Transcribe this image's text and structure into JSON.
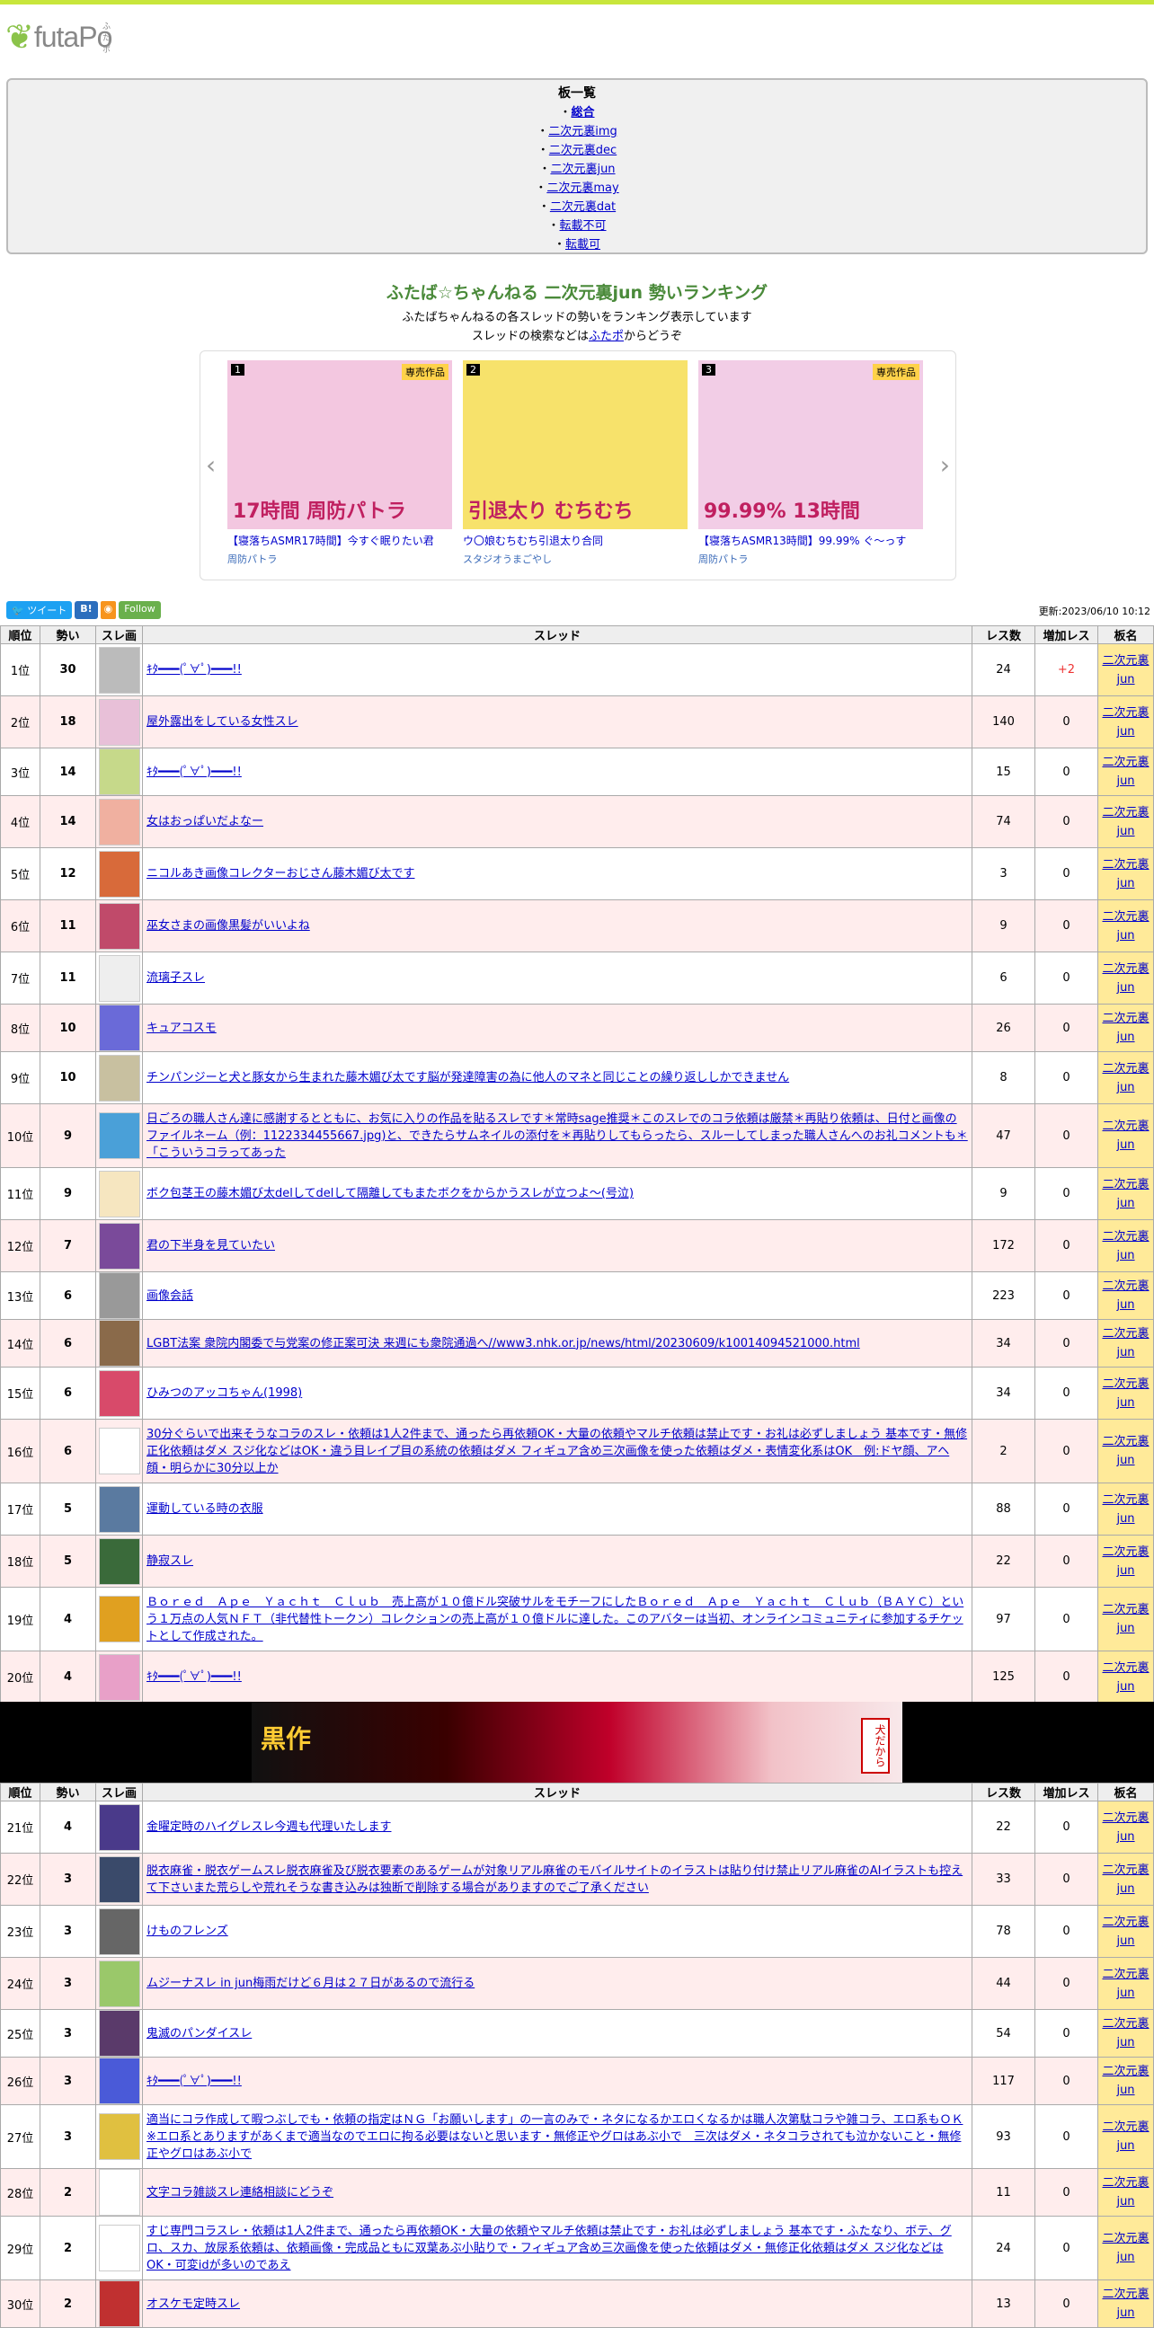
{
  "site": {
    "logo_mark": "❦",
    "logo_text": "futaPo",
    "logo_sub": "ふたポ"
  },
  "boards": {
    "heading": "板一覧",
    "items": [
      {
        "prefix": "・",
        "label": "総合"
      },
      {
        "prefix": "・",
        "label": "二次元裏img"
      },
      {
        "prefix": "・",
        "label": "二次元裏dec"
      },
      {
        "prefix": "・",
        "label": "二次元裏jun"
      },
      {
        "prefix": "・",
        "label": "二次元裏may"
      },
      {
        "prefix": "・",
        "label": "二次元裏dat"
      },
      {
        "prefix": "・",
        "label": "転載不可"
      },
      {
        "prefix": "・",
        "label": "転載可"
      }
    ]
  },
  "ranking": {
    "title": "ふたば☆ちゃんねる 二次元裏jun 勢いランキング",
    "desc1": "ふたばちゃんねるの各スレッドの勢いをランキング表示しています",
    "desc2_pre": "スレッドの検索などは",
    "desc2_link": "ふたポ",
    "desc2_post": "からどうぞ"
  },
  "carousel": {
    "prev": "‹",
    "next": "›",
    "items": [
      {
        "num": "1",
        "badge": "専売作品",
        "title": "【寝落ちASMR17時間】今すぐ眠りたい君",
        "circle": "周防パトラ",
        "bg": "#f3c7e0",
        "img_text": "17時間 周防パトラ"
      },
      {
        "num": "2",
        "badge": "",
        "title": "ウ〇娘むちむち引退太り合同",
        "circle": "スタジオうまごやし",
        "bg": "#f7e26b",
        "img_text": "引退太り むちむち"
      },
      {
        "num": "3",
        "badge": "専売作品",
        "title": "【寝落ちASMR13時間】99.99% ぐ～っす",
        "circle": "周防パトラ",
        "bg": "#f2cde6",
        "img_text": "99.99% 13時間"
      }
    ]
  },
  "share": {
    "tweet": "ツイート",
    "hatena": "B!",
    "rss": "RSS",
    "follow": "Follow"
  },
  "updated": "更新:2023/06/10 10:12",
  "table": {
    "headers": [
      "順位",
      "勢い",
      "スレ画",
      "スレッド",
      "レス数",
      "増加レス",
      "板名"
    ],
    "board_line1": "二次元裏",
    "board_line2": "jun",
    "rows": [
      {
        "rank": "1位",
        "ikioi": "30",
        "title": "ｷﾀ━━━(ﾟ∀ﾟ)━━━!!",
        "res": "24",
        "inc": "+2",
        "h": 58,
        "img": "#bbb"
      },
      {
        "rank": "2位",
        "ikioi": "18",
        "title": "屋外露出をしている女性スレ",
        "res": "140",
        "inc": "0",
        "h": 58,
        "img": "#e8c0d8"
      },
      {
        "rank": "3位",
        "ikioi": "14",
        "title": "ｷﾀ━━━(ﾟ∀ﾟ)━━━!!",
        "res": "15",
        "inc": "0",
        "h": 46,
        "img": "#c6d98a"
      },
      {
        "rank": "4位",
        "ikioi": "14",
        "title": "女はおっぱいだよなー",
        "res": "74",
        "inc": "0",
        "h": 58,
        "img": "#f0b0a0"
      },
      {
        "rank": "5位",
        "ikioi": "12",
        "title": "ニコルあき画像コレクターおじさん藤木媚び太です",
        "res": "3",
        "inc": "0",
        "h": 58,
        "img": "#d86a3a"
      },
      {
        "rank": "6位",
        "ikioi": "11",
        "title": "巫女さまの画像黒髪がいいよね",
        "res": "9",
        "inc": "0",
        "h": 58,
        "img": "#c04a6a"
      },
      {
        "rank": "7位",
        "ikioi": "11",
        "title": "流璃子スレ",
        "res": "6",
        "inc": "0",
        "h": 58,
        "img": "#eee"
      },
      {
        "rank": "8位",
        "ikioi": "10",
        "title": "キュアコスモ",
        "res": "26",
        "inc": "0",
        "h": 44,
        "img": "#6a6ad8"
      },
      {
        "rank": "9位",
        "ikioi": "10",
        "title": "チンパンジーと犬と豚女から生まれた藤木媚び太です脳が発達障害の為に他人のマネと同じことの繰り返ししかできません",
        "res": "8",
        "inc": "0",
        "h": 58,
        "img": "#c8c0a0"
      },
      {
        "rank": "10位",
        "ikioi": "9",
        "title": "日ごろの職人さん達に感謝するとともに、お気に入りの作品を貼るスレです＊常時sage推奨＊このスレでのコラ依頼は厳禁＊再貼り依頼は、日付と画像のファイルネーム（例：1122334455667.jpg)と、できたらサムネイルの添付を＊再貼りしてもらったら、スルーしてしまった職人さんへのお礼コメントも＊「こういうコラってあった",
        "res": "47",
        "inc": "0",
        "h": 71,
        "img": "#4aa0d8"
      },
      {
        "rank": "11位",
        "ikioi": "9",
        "title": "ボク包茎王の藤木媚び太delしてdelして隔離してもまたボクをからかうスレが立つよ～(号泣)",
        "res": "9",
        "inc": "0",
        "h": 58,
        "img": "#f6e6c0"
      },
      {
        "rank": "12位",
        "ikioi": "7",
        "title": "君の下半身を見ていたい",
        "res": "172",
        "inc": "0",
        "h": 58,
        "img": "#7a4a9a"
      },
      {
        "rank": "13位",
        "ikioi": "6",
        "title": "画像会話",
        "res": "223",
        "inc": "0",
        "h": 44,
        "img": "#999"
      },
      {
        "rank": "14位",
        "ikioi": "6",
        "title": "LGBT法案 衆院内閣委で与党案の修正案可決 来週にも衆院通過へ//www3.nhk.or.jp/news/html/20230609/k10014094521000.html",
        "res": "34",
        "inc": "0",
        "h": 44,
        "img": "#8a6a4a"
      },
      {
        "rank": "15位",
        "ikioi": "6",
        "title": "ひみつのアッコちゃん(1998)",
        "res": "34",
        "inc": "0",
        "h": 58,
        "img": "#d84a6a"
      },
      {
        "rank": "16位",
        "ikioi": "6",
        "title": "30分ぐらいで出来そうなコラのスレ・依頼は1人2件まで、通ったら再依頼OK・大量の依頼やマルチ依頼は禁止です・お礼は必ずしましょう 基本です・無修正化依頼はダメ スジ化などはOK・違う目レイプ目の系統の依頼はダメ フィギュア含め三次画像を使った依頼はダメ・表情変化系はOK　例:ドヤ顔、アヘ顔・明らかに30分以上か",
        "res": "2",
        "inc": "0",
        "h": 71,
        "img": "#fff"
      },
      {
        "rank": "17位",
        "ikioi": "5",
        "title": "運動している時の衣服",
        "res": "88",
        "inc": "0",
        "h": 58,
        "img": "#5a7aa0"
      },
      {
        "rank": "18位",
        "ikioi": "5",
        "title": "静寂スレ",
        "res": "22",
        "inc": "0",
        "h": 58,
        "img": "#3a6a3a"
      },
      {
        "rank": "19位",
        "ikioi": "4",
        "title": "Ｂｏｒｅｄ　Ａｐｅ　Ｙａｃｈｔ　Ｃｌｕｂ　売上高が１０億ドル突破サルをモチーフにしたＢｏｒｅｄ　Ａｐｅ　Ｙａｃｈｔ　Ｃｌｕｂ（ＢＡＹＣ）という１万点の人気ＮＦＴ（非代替性トークン）コレクションの売上高が１０億ドルに達した。このアバターは当初、オンラインコミュニティに参加するチケットとして作成された。",
        "res": "97",
        "inc": "0",
        "h": 71,
        "img": "#e0a020"
      },
      {
        "rank": "20位",
        "ikioi": "4",
        "title": "ｷﾀ━━━(ﾟ∀ﾟ)━━━!!",
        "res": "125",
        "inc": "0",
        "h": 58,
        "img": "#e8a0c8"
      }
    ],
    "rows2": [
      {
        "rank": "21位",
        "ikioi": "4",
        "title": "金曜定時のハイグレスレ今週も代理いたします",
        "res": "22",
        "inc": "0",
        "h": 58,
        "img": "#4a3a8a"
      },
      {
        "rank": "22位",
        "ikioi": "3",
        "title": "脱衣麻雀・脱衣ゲームスレ脱衣麻雀及び脱衣要素のあるゲームが対象リアル麻雀のモバイルサイトのイラストは貼り付け禁止リアル麻雀のAIイラストも控えて下さいまた荒らしや荒れそうな書き込みは独断で削除する場合がありますのでご了承ください",
        "res": "33",
        "inc": "0",
        "h": 58,
        "img": "#3a4a6a"
      },
      {
        "rank": "23位",
        "ikioi": "3",
        "title": "けものフレンズ",
        "res": "78",
        "inc": "0",
        "h": 58,
        "img": "#666"
      },
      {
        "rank": "24位",
        "ikioi": "3",
        "title": "ムジーナスレ in jun梅雨だけど６月は２７日があるので流行る",
        "res": "44",
        "inc": "0",
        "h": 58,
        "img": "#9ac86a"
      },
      {
        "rank": "25位",
        "ikioi": "3",
        "title": "鬼滅のパンダイスレ",
        "res": "54",
        "inc": "0",
        "h": 44,
        "img": "#5a3a6a"
      },
      {
        "rank": "26位",
        "ikioi": "3",
        "title": "ｷﾀ━━━(ﾟ∀ﾟ)━━━!!",
        "res": "117",
        "inc": "0",
        "h": 44,
        "img": "#4a5ad8"
      },
      {
        "rank": "27位",
        "ikioi": "3",
        "title": "適当にコラ作成して暇つぶしでも・依頼の指定はＮＧ「お願いします」の一言のみで・ネタになるかエロくなるかは職人次第駄コラや雑コラ、エロ系もＯＫ※エロ系とありますがあくまで適当なのでエロに拘る必要はないと思います・無修正やグロはあぶ小で　三次はダメ・ネタコラされても泣かないこと・無修正やグロはあぶ小で",
        "res": "93",
        "inc": "0",
        "h": 71,
        "img": "#e0c040"
      },
      {
        "rank": "28位",
        "ikioi": "2",
        "title": "文字コラ雑談スレ連絡相談にどうぞ",
        "res": "11",
        "inc": "0",
        "h": 44,
        "img": "#fff"
      },
      {
        "rank": "29位",
        "ikioi": "2",
        "title": "すじ専門コラスレ・依頼は1人2件まで、通ったら再依頼OK・大量の依頼やマルチ依頼は禁止です・お礼は必ずしましょう 基本です・ふたなり、ボテ、グロ、スカ、放尿系依頼は、依頼画像・完成品ともに双葉あぶ小貼りで・フィギュア含め三次画像を使った依頼はダメ・無修正化依頼はダメ スジ化などはOK・可変idが多いのであえ",
        "res": "24",
        "inc": "0",
        "h": 71,
        "img": "#fff"
      },
      {
        "rank": "30位",
        "ikioi": "2",
        "title": "オスケモ定時スレ",
        "res": "13",
        "inc": "0",
        "h": 44,
        "img": "#c03030"
      }
    ]
  },
  "banner": {
    "logo": "黒作",
    "tag": "犬だから"
  },
  "colors": {
    "board_bg": "#ffea99",
    "row_alt": "#ffeded",
    "title_green": "#4a8a3a",
    "link": "#0000cc",
    "topbar": "#c8e63c"
  }
}
